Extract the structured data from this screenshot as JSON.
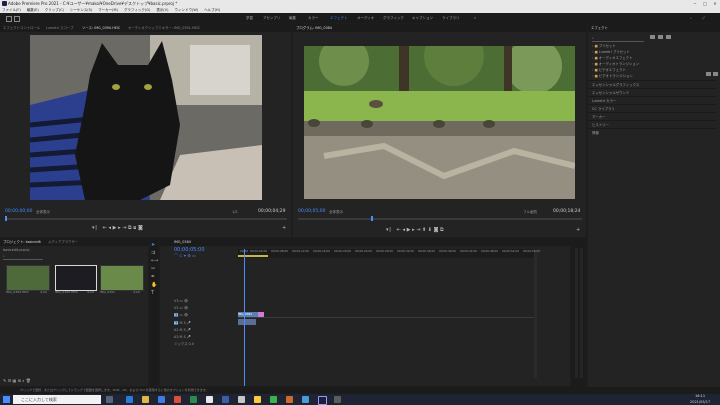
{
  "window": {
    "title": "Adobe Premiere Pro 2021 - C:¥ユーザー¥makoi¥OneDrive¥デスクトップ¥basic.prproj *",
    "minimize": "─",
    "maximize": "□",
    "close": "✕"
  },
  "menu": [
    "ファイル(F)",
    "編集(E)",
    "クリップ(C)",
    "シーケンス(S)",
    "マーカー(M)",
    "グラフィック(G)",
    "表示(V)",
    "ウィンドウ(W)",
    "ヘルプ(H)"
  ],
  "workspaces": [
    "学習",
    "アセンブリ",
    "編集",
    "カラー",
    "エフェクト",
    "オーディオ",
    "グラフィック",
    "キャプション",
    "ライブラリ"
  ],
  "workspace_active": "エフェクト",
  "source_panel": {
    "tabs": [
      "エフェクトコントロール",
      "Lumetri スコープ",
      "ソース: IMG_0390.HEIC",
      "オーディオクリップミキサー: IMG_0391.HEIC"
    ],
    "timecode": "00;00;00;00",
    "fit": "全体表示",
    "duration": "00;00;04;29",
    "ratio": "1/2"
  },
  "program_panel": {
    "tab": "プログラム: IMG_0384",
    "timecode": "00;00;05;00",
    "fit": "全体表示",
    "quality": "フル画質",
    "duration": "00;00;18;24"
  },
  "effects_panel": {
    "tab": "エフェクト",
    "folders": [
      "プリセット",
      "Lumetri プリセット",
      "オーディオエフェクト",
      "オーディオトランジション",
      "ビデオエフェクト",
      "ビデオトランジション"
    ],
    "sections": [
      "エッセンシャルグラフィックス",
      "エッセンシャルサウンド",
      "Lumetri カラー",
      "CC ライブラリ",
      "マーカー",
      "ヒストリー",
      "情報"
    ]
  },
  "project_panel": {
    "tabs": [
      "プロジェクト: basicedit",
      "メディアブラウザー"
    ],
    "file": "basicedit.prproj",
    "clips": [
      {
        "name": "IMG_0384.HEIC",
        "dur": "4;29"
      },
      {
        "name": "IMG_0390.HEIC",
        "dur": "4;29"
      },
      {
        "name": "IMG_0391",
        "dur": "4;29"
      }
    ]
  },
  "timeline": {
    "tab": "IMG_0384",
    "timecode": "00;00;05;00",
    "ruler": [
      "00;00",
      "00;00;04;00",
      "00;00;08;00",
      "00;00;12;00",
      "00;00;16;00",
      "00;00;20;00",
      "00;00;24;00",
      "00;00;28;00",
      "00;00;32;00",
      "00;00;36;00",
      "00;00;40;00",
      "00;00;44;00",
      "00;00;48;00",
      "00;00;52;00",
      "00;00;56;00"
    ],
    "video_tracks": [
      "V3",
      "V2",
      "V1"
    ],
    "audio_tracks": [
      "A1",
      "A2",
      "A3"
    ],
    "mix": "ミックス",
    "mix_value": "0.0",
    "clip_label": "IMG_0384"
  },
  "status_bar": "クリックで選択、またはクリックしてドラッグで範囲を選択します。Shift、Alt、および Ctrl を使用すると他のオプションを利用できます。",
  "taskbar": {
    "search": "ここに入力して検索",
    "time": "16:11",
    "date": "2021/05/17"
  },
  "colors": {
    "accent": "#4a8cff",
    "panel": "#232323",
    "background": "#1d1d1d",
    "clip_video": "#5a7fb5",
    "clip_fx": "#d27ad6"
  }
}
